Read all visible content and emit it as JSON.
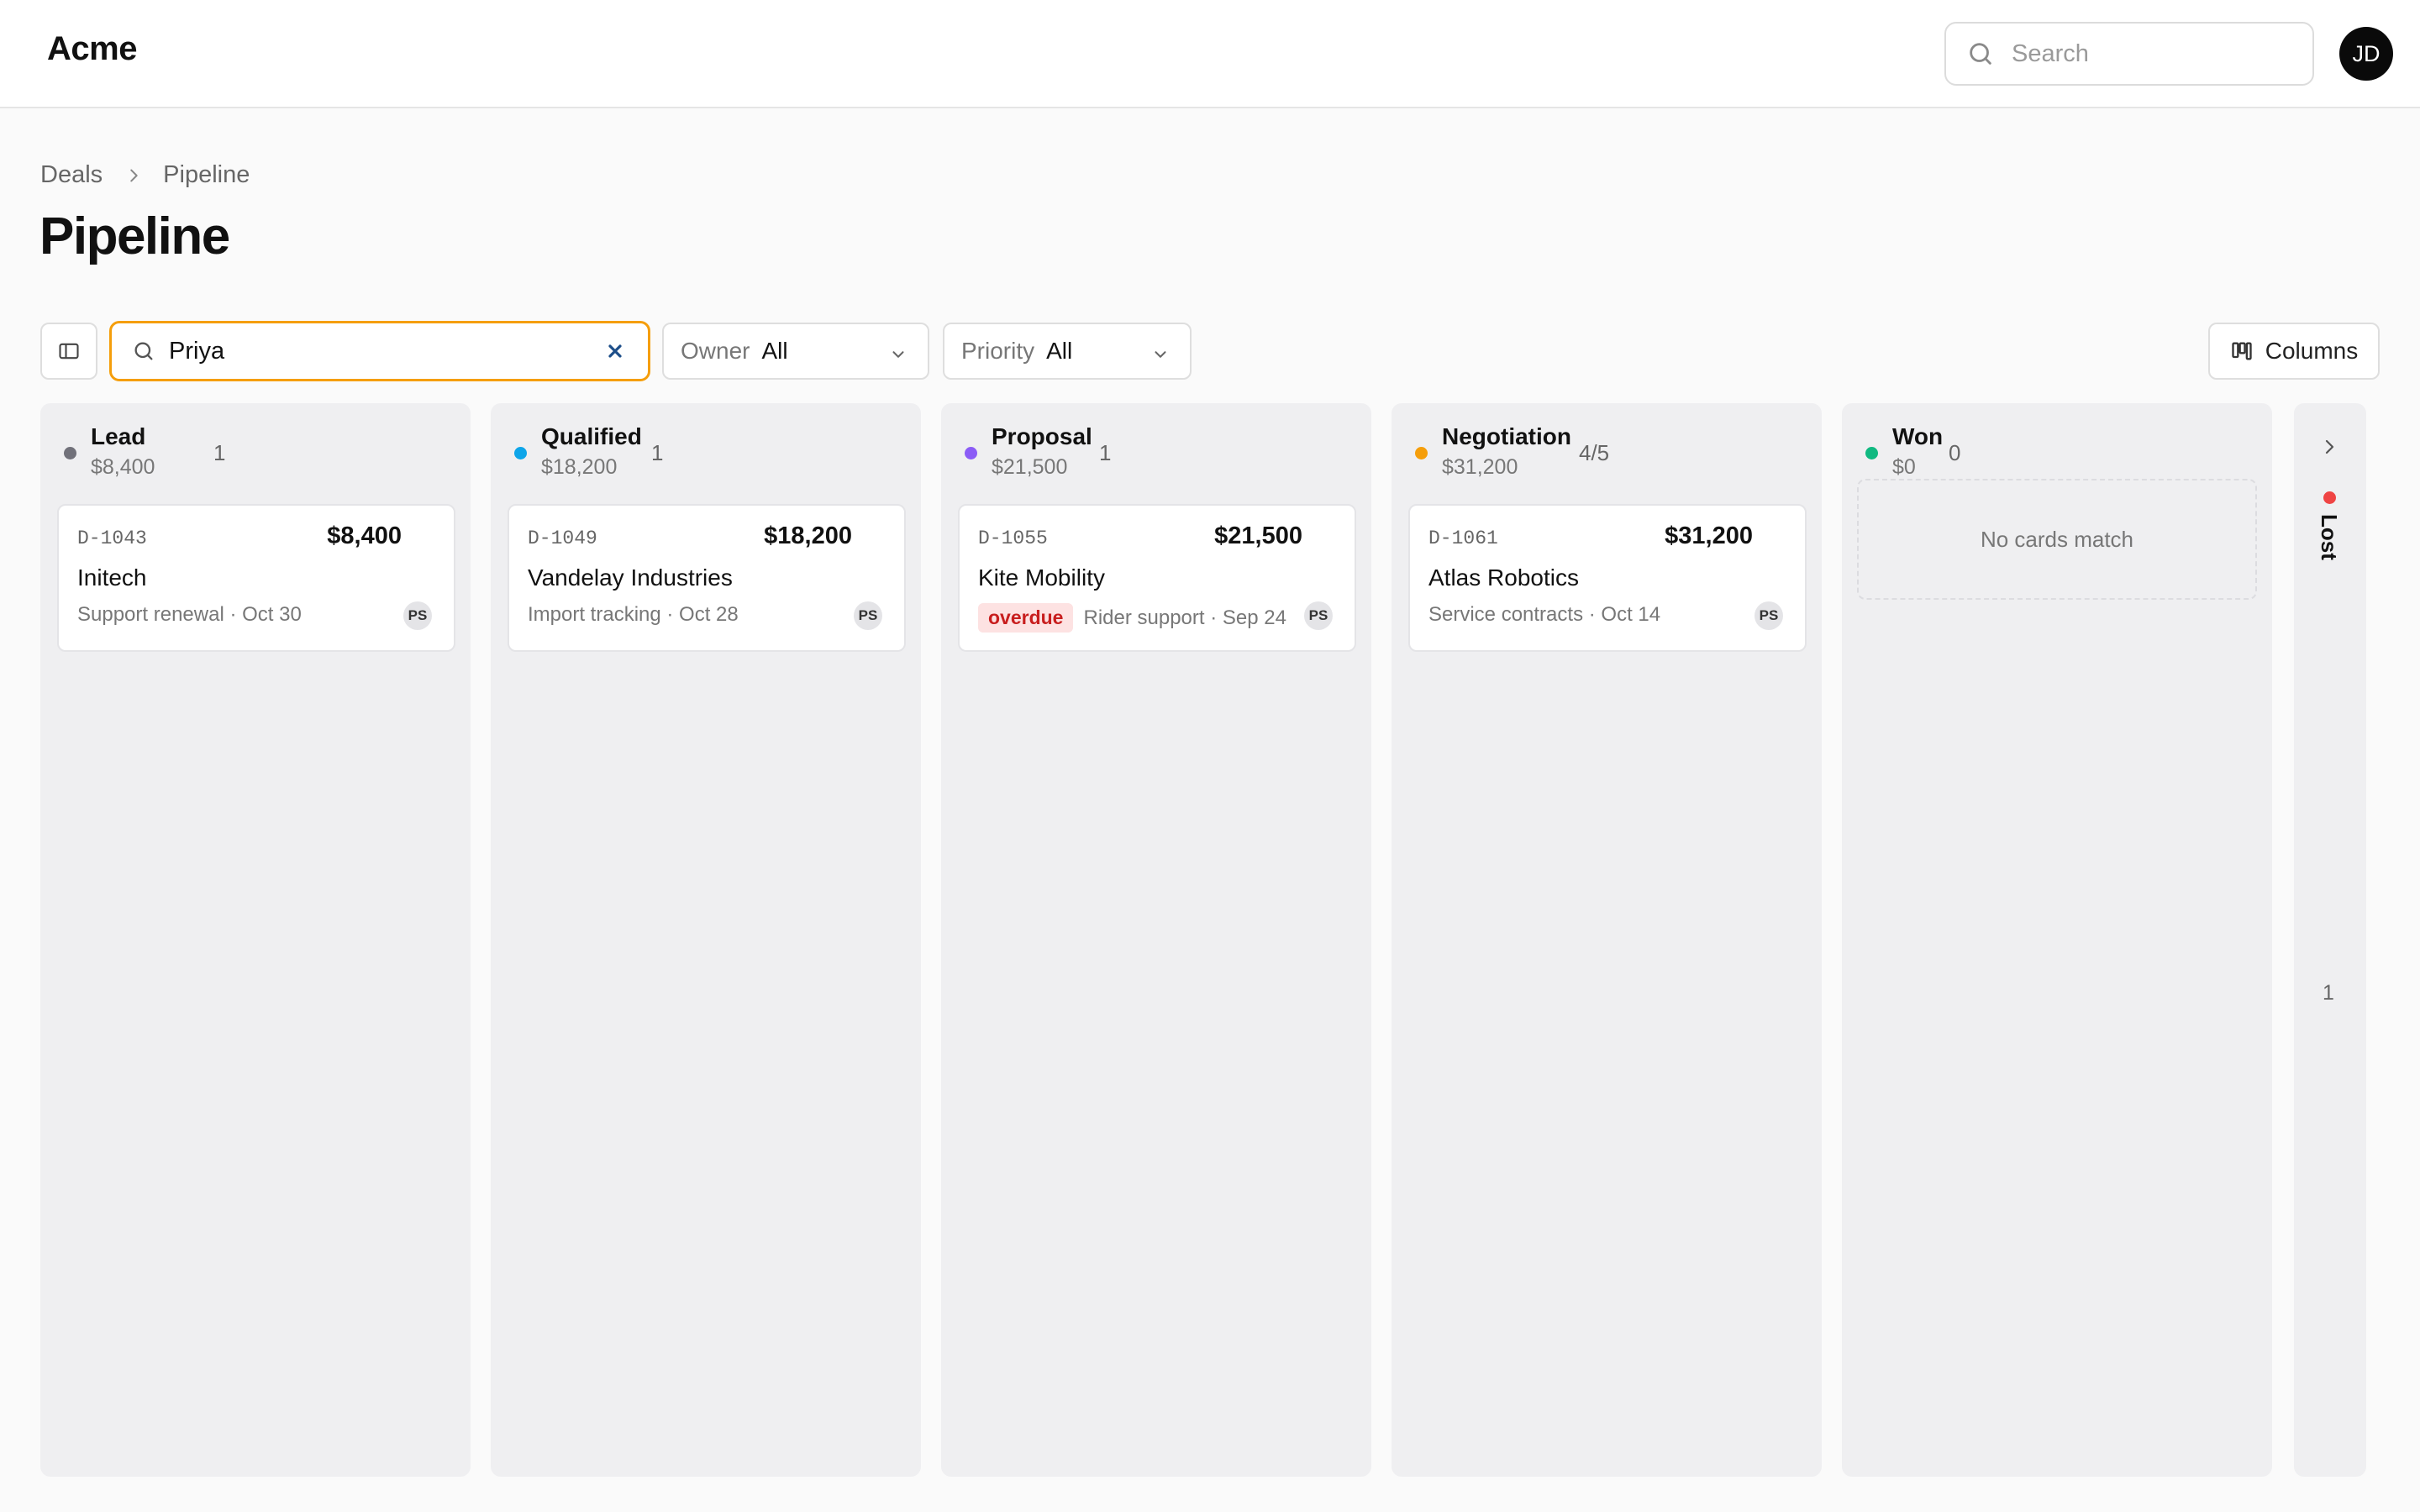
{
  "app": {
    "brand": "Acme"
  },
  "header": {
    "search_placeholder": "Search",
    "avatar_initials": "JD"
  },
  "breadcrumb": {
    "items": [
      "Deals",
      "Pipeline"
    ]
  },
  "page": {
    "title": "Pipeline"
  },
  "toolbar": {
    "filter_value": "Priya",
    "owner": {
      "label": "Owner",
      "value": "All"
    },
    "priority": {
      "label": "Priority",
      "value": "All"
    },
    "columns_label": "Columns"
  },
  "columns": [
    {
      "name": "Lead",
      "total": "$8,400",
      "count": "1",
      "dot_color": "#71717a",
      "cards": [
        {
          "id": "D-1043",
          "amount": "$8,400",
          "company": "Initech",
          "meta": "Support renewal · Oct 30",
          "owner": "PS"
        }
      ]
    },
    {
      "name": "Qualified",
      "total": "$18,200",
      "count": "1",
      "dot_color": "#0ea5e9",
      "cards": [
        {
          "id": "D-1049",
          "amount": "$18,200",
          "company": "Vandelay Industries",
          "meta": "Import tracking · Oct 28",
          "owner": "PS"
        }
      ]
    },
    {
      "name": "Proposal",
      "total": "$21,500",
      "count": "1",
      "dot_color": "#8b5cf6",
      "cards": [
        {
          "id": "D-1055",
          "amount": "$21,500",
          "company": "Kite Mobility",
          "badge": "overdue",
          "meta": "Rider support · Sep 24",
          "owner": "PS"
        }
      ]
    },
    {
      "name": "Negotiation",
      "total": "$31,200",
      "count": "4/5",
      "dot_color": "#f59e0b",
      "cards": [
        {
          "id": "D-1061",
          "amount": "$31,200",
          "company": "Atlas Robotics",
          "meta": "Service contracts · Oct 14",
          "owner": "PS"
        }
      ]
    },
    {
      "name": "Won",
      "total": "$0",
      "count": "0",
      "dot_color": "#10b981",
      "empty_text": "No cards match"
    }
  ],
  "collapsed_column": {
    "name": "Lost",
    "count": "1",
    "dot_color": "#ef4444"
  }
}
